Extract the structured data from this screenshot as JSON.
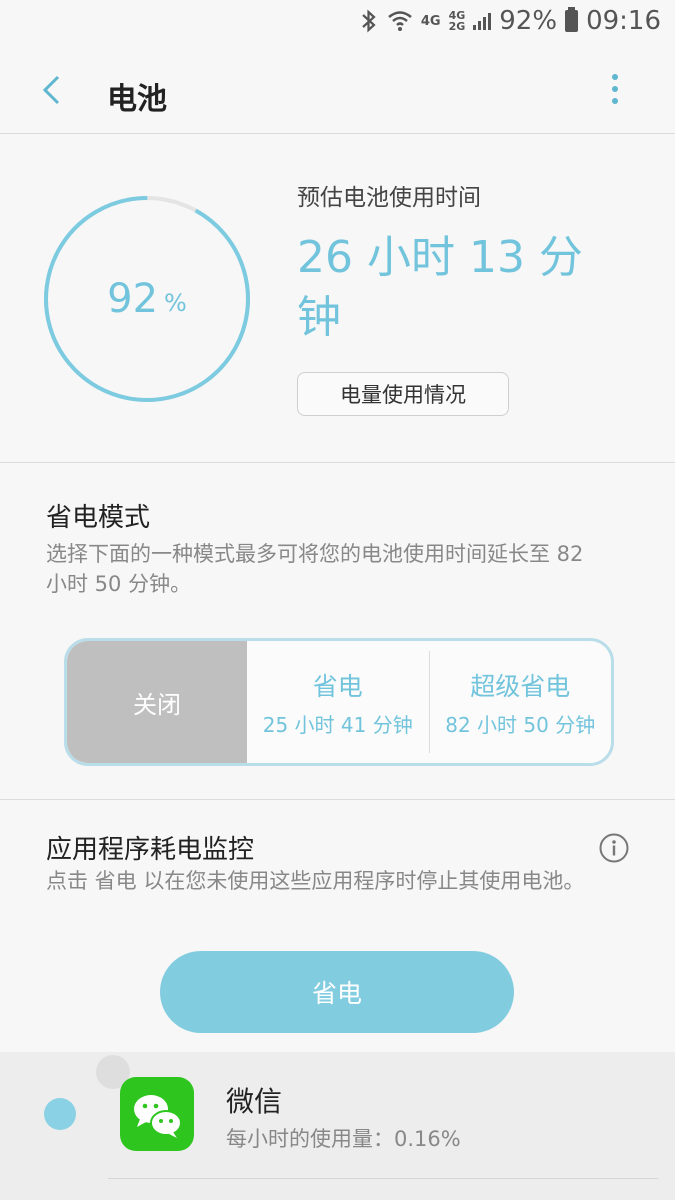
{
  "status_bar": {
    "net1": "4G",
    "net2_top": "4G",
    "net2_bottom": "2G",
    "battery": "92%",
    "time": "09:16"
  },
  "header": {
    "title": "电池"
  },
  "battery": {
    "percent_value": "92",
    "percent_unit": "%",
    "level_fraction": 0.92,
    "estimate_label": "预估电池使用时间",
    "estimate_value": "26 小时 13 分钟",
    "usage_button": "电量使用情况"
  },
  "power_mode": {
    "title": "省电模式",
    "description": "选择下面的一种模式最多可将您的电池使用时间延长至 82 小时 50 分钟。",
    "off_label": "关闭",
    "options": [
      {
        "name": "省电",
        "duration": "25 小时 41 分钟"
      },
      {
        "name": "超级省电",
        "duration": "82 小时 50 分钟"
      }
    ]
  },
  "app_monitor": {
    "title": "应用程序耗电监控",
    "description": "点击 省电 以在您未使用这些应用程序时停止其使用电池。",
    "save_button": "省电"
  },
  "apps": [
    {
      "name": "微信",
      "usage": "每小时的使用量：0.16%",
      "icon": "wechat-icon"
    }
  ],
  "colors": {
    "accent": "#72c4dc",
    "button": "#82cce0",
    "wechat": "#2ec51f"
  }
}
